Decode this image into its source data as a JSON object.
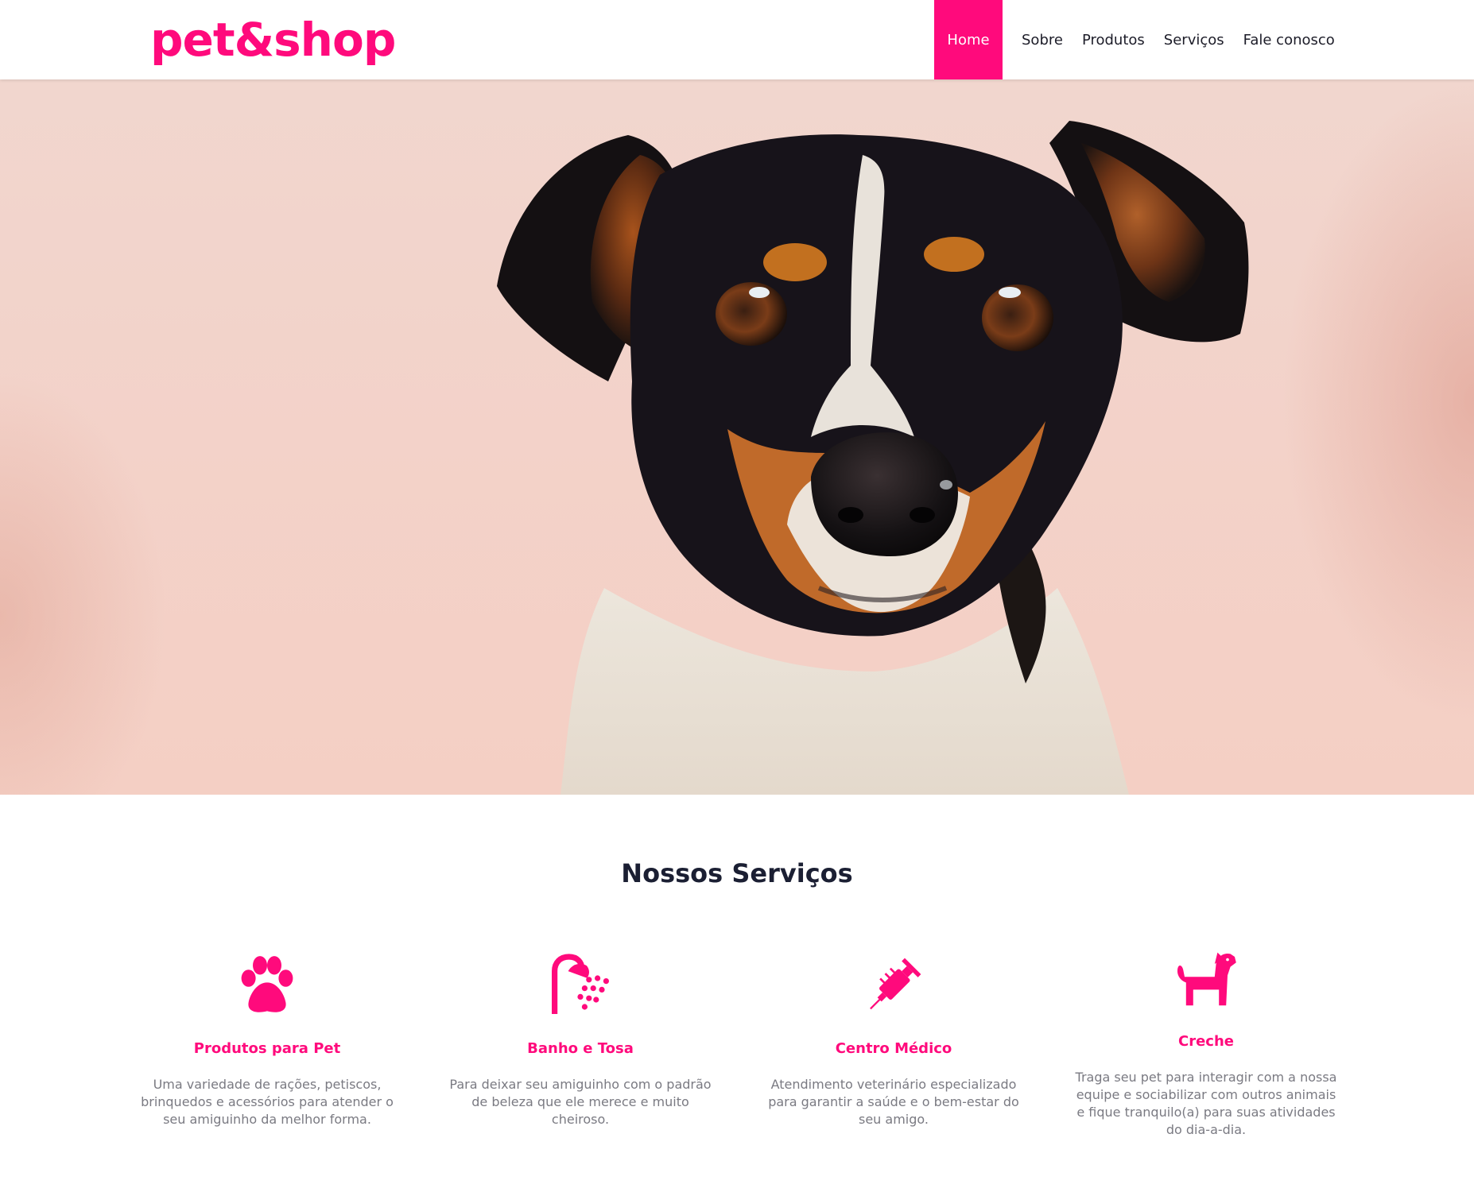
{
  "brand": {
    "logo_text": "pet&shop",
    "accent_color": "#ff0a7c"
  },
  "nav": {
    "items": [
      {
        "label": "Home",
        "active": true
      },
      {
        "label": "Sobre",
        "active": false
      },
      {
        "label": "Produtos",
        "active": false
      },
      {
        "label": "Serviços",
        "active": false
      },
      {
        "label": "Fale conosco",
        "active": false
      }
    ]
  },
  "hero": {
    "image": "dog-portrait-photo"
  },
  "services": {
    "title": "Nossos Serviços",
    "items": [
      {
        "icon": "paw-icon",
        "name": "Produtos para Pet",
        "description": "Uma variedade de rações, petiscos, brinquedos e acessórios para atender o seu amiguinho da melhor forma."
      },
      {
        "icon": "shower-icon",
        "name": "Banho e Tosa",
        "description": "Para deixar seu amiguinho com o padrão de beleza que ele merece e muito cheiroso."
      },
      {
        "icon": "syringe-icon",
        "name": "Centro Médico",
        "description": "Atendimento veterinário especializado para garantir a saúde e o bem-estar do seu amigo."
      },
      {
        "icon": "dog-icon",
        "name": "Creche",
        "description": "Traga seu pet para interagir com a nossa equipe e sociabilizar com outros animais e fique tranquilo(a) para suas atividades do dia-a-dia."
      }
    ]
  }
}
